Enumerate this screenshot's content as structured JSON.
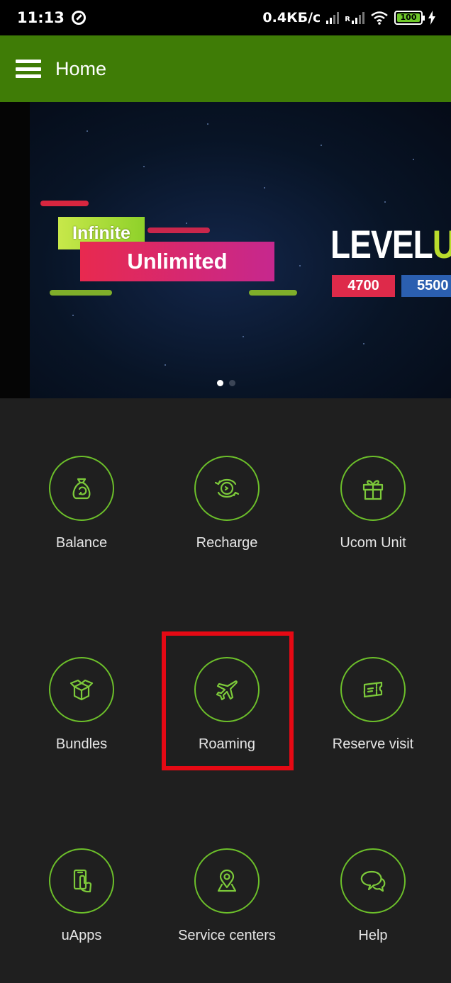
{
  "status_bar": {
    "time": "11:13",
    "net_speed": "0.4КБ/с",
    "sim2_label": "R",
    "battery": "100"
  },
  "app_bar": {
    "title": "Home"
  },
  "banner": {
    "tag_infinite": "Infinite",
    "tag_unlimited": "Unlimited",
    "level_text": "LEVEL",
    "level_text_accent": "U",
    "prices": [
      "4700",
      "5500"
    ],
    "pages": 2,
    "active_page": 1
  },
  "menu": {
    "items": [
      {
        "label": "Balance",
        "icon": "money-bag-icon"
      },
      {
        "label": "Recharge",
        "icon": "recharge-icon"
      },
      {
        "label": "Ucom Unit",
        "icon": "gift-icon"
      },
      {
        "label": "Bundles",
        "icon": "box-icon"
      },
      {
        "label": "Roaming",
        "icon": "airplane-icon"
      },
      {
        "label": "Reserve visit",
        "icon": "ticket-icon"
      },
      {
        "label": "uApps",
        "icon": "phone-touch-icon"
      },
      {
        "label": "Service centers",
        "icon": "location-pin-icon"
      },
      {
        "label": "Help",
        "icon": "chat-bubbles-icon"
      }
    ]
  },
  "colors": {
    "app_bar": "#3f7c06",
    "accent": "#6cbf2a",
    "background": "#1f1f1f",
    "highlight": "#e50914"
  }
}
